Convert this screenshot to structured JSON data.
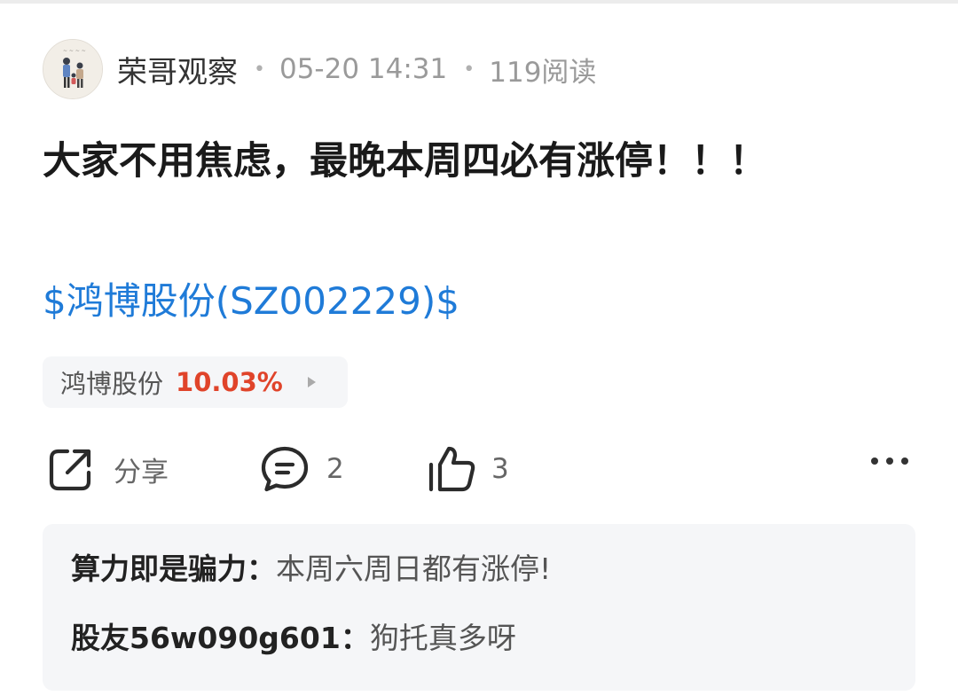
{
  "post": {
    "author": "荣哥观察",
    "date": "05-20 14:31",
    "reads": "119阅读",
    "title": "大家不用焦虑，最晚本周四必有涨停！！！",
    "stock_link": "$鸿博股份(SZ002229)$"
  },
  "stock_chip": {
    "name": "鸿博股份",
    "change": "10.03%"
  },
  "actions": {
    "share_label": "分享",
    "comment_count": "2",
    "like_count": "3"
  },
  "comments": [
    {
      "user": "算力即是骗力",
      "separator": "：",
      "text": "本周六周日都有涨停!"
    },
    {
      "user": "股友56w090g601",
      "separator": "：",
      "text": "狗托真多呀"
    }
  ],
  "colors": {
    "link": "#1f7bd8",
    "up": "#e0442a",
    "panel_bg": "#f5f6f8"
  },
  "icons": [
    "avatar-image",
    "share-icon",
    "comment-icon",
    "thumbs-up-icon",
    "play-arrow-icon",
    "more-icon"
  ]
}
